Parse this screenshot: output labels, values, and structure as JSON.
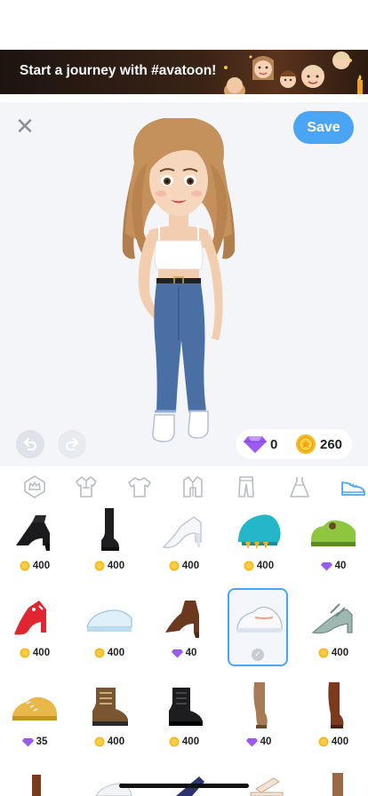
{
  "banner": {
    "text": "Start a journey with #avatoon!"
  },
  "editor": {
    "save_label": "Save"
  },
  "currency": {
    "gems": "0",
    "coins": "260"
  },
  "tabs": [
    {
      "icon": "crown-icon"
    },
    {
      "icon": "outfit-icon"
    },
    {
      "icon": "tshirt-icon"
    },
    {
      "icon": "jacket-icon"
    },
    {
      "icon": "pants-icon"
    },
    {
      "icon": "dress-icon"
    },
    {
      "icon": "shoe-icon",
      "active": true
    }
  ],
  "items": [
    {
      "name": "black-ankle-bootie",
      "currency": "coin",
      "price": "400"
    },
    {
      "name": "black-tall-boot",
      "currency": "coin",
      "price": "400"
    },
    {
      "name": "white-glass-heel",
      "currency": "coin",
      "price": "400"
    },
    {
      "name": "teal-monster-paw-shoe",
      "currency": "coin",
      "price": "400"
    },
    {
      "name": "green-sneaker",
      "currency": "gem",
      "price": "40"
    },
    {
      "name": "red-strappy-heel",
      "currency": "coin",
      "price": "400"
    },
    {
      "name": "light-blue-sneaker",
      "currency": "coin",
      "price": "400"
    },
    {
      "name": "brown-heeled-bootie",
      "currency": "gem",
      "price": "40"
    },
    {
      "name": "white-sneaker",
      "selected": true
    },
    {
      "name": "silver-sandal",
      "currency": "coin",
      "price": "400"
    },
    {
      "name": "gold-sneaker",
      "currency": "gem",
      "price": "35"
    },
    {
      "name": "brown-combat-boot",
      "currency": "coin",
      "price": "400"
    },
    {
      "name": "black-combat-boot",
      "currency": "coin",
      "price": "400"
    },
    {
      "name": "tan-knee-boot",
      "currency": "gem",
      "price": "40"
    },
    {
      "name": "brown-knee-boot",
      "currency": "coin",
      "price": "400"
    }
  ],
  "colors": {
    "accent": "#4aa5f5",
    "gem": "#9b59f5",
    "coin": "#f6b820"
  }
}
